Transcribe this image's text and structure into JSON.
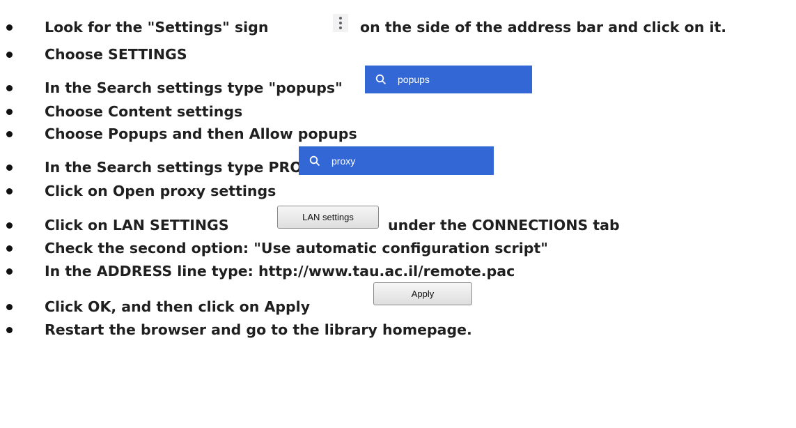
{
  "steps": [
    {
      "before": "Look for the \"Settings\" sign",
      "after": "on the side of the address bar and click on it."
    },
    {
      "text": "Choose SETTINGS"
    },
    {
      "text": "In the Search settings type \"popups\""
    },
    {
      "text": "Choose Content settings"
    },
    {
      "text": "Choose Popups and then Allow popups"
    },
    {
      "text": "In the Search settings type PROXY"
    },
    {
      "text": "Click on Open proxy settings"
    },
    {
      "before": "Click on LAN SETTINGS",
      "after": "under the CONNECTIONS tab"
    },
    {
      "text": "Check the second option: \"Use automatic configuration script\""
    },
    {
      "text": "In the ADDRESS line type: http://www.tau.ac.il/remote.pac"
    },
    {
      "text": "Click OK, and then click on Apply"
    },
    {
      "text": "Restart the browser and go to the library homepage."
    }
  ],
  "images": {
    "settings_icon": "vertical-dots-icon",
    "search_popups": {
      "icon": "search-icon",
      "label": "popups"
    },
    "search_proxy": {
      "icon": "search-icon",
      "label": "proxy"
    },
    "lan_button": "LAN settings",
    "apply_button": "Apply"
  },
  "colors": {
    "search_chip_bg": "#3367d6",
    "text": "#1f1f1f"
  }
}
